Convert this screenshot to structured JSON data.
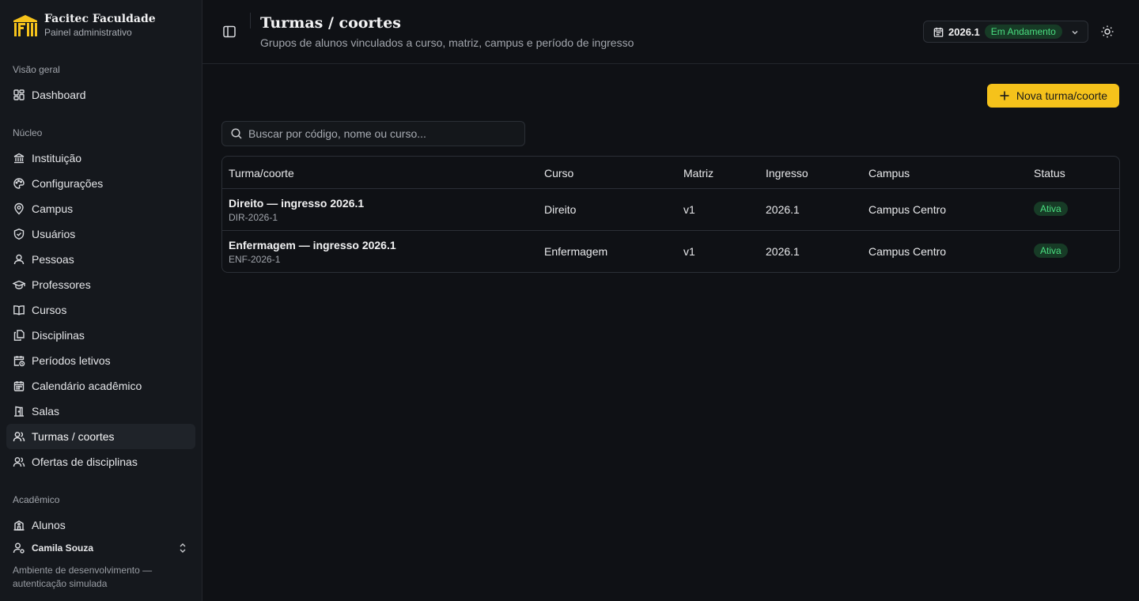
{
  "brand": {
    "title": "Facitec Faculdade",
    "subtitle": "Painel administrativo",
    "accent": "#f5c21b"
  },
  "sidebar": {
    "sections": [
      {
        "label": "Visão geral",
        "items": [
          {
            "label": "Dashboard",
            "icon": "dashboard-icon"
          }
        ]
      },
      {
        "label": "Núcleo",
        "items": [
          {
            "label": "Instituição",
            "icon": "institution-icon"
          },
          {
            "label": "Configurações",
            "icon": "palette-icon"
          },
          {
            "label": "Campus",
            "icon": "map-pin-icon"
          },
          {
            "label": "Usuários",
            "icon": "shield-icon"
          },
          {
            "label": "Pessoas",
            "icon": "user-icon"
          },
          {
            "label": "Professores",
            "icon": "graduation-cap-icon"
          },
          {
            "label": "Cursos",
            "icon": "book-icon"
          },
          {
            "label": "Disciplinas",
            "icon": "files-icon"
          },
          {
            "label": "Períodos letivos",
            "icon": "calendar-clock-icon"
          },
          {
            "label": "Calendário acadêmico",
            "icon": "calendar-icon"
          },
          {
            "label": "Salas",
            "icon": "door-icon"
          },
          {
            "label": "Turmas / coortes",
            "icon": "users-icon",
            "active": true
          },
          {
            "label": "Ofertas de disciplinas",
            "icon": "users-icon"
          }
        ]
      },
      {
        "label": "Acadêmico",
        "items": [
          {
            "label": "Alunos",
            "icon": "school-icon"
          }
        ]
      }
    ],
    "user": {
      "name": "Camila Souza"
    },
    "env_note": "Ambiente de desenvolvimento — autenticação simulada"
  },
  "header": {
    "title": "Turmas / coortes",
    "subtitle": "Grupos de alunos vinculados a curso, matriz, campus e período de ingresso",
    "period": {
      "year": "2026.1",
      "status": "Em Andamento"
    }
  },
  "actions": {
    "new_label": "Nova turma/coorte"
  },
  "search": {
    "placeholder": "Buscar por código, nome ou curso..."
  },
  "table": {
    "columns": [
      "Turma/coorte",
      "Curso",
      "Matriz",
      "Ingresso",
      "Campus",
      "Status"
    ],
    "rows": [
      {
        "name": "Direito — ingresso 2026.1",
        "code": "DIR-2026-1",
        "course": "Direito",
        "matrix": "v1",
        "entry": "2026.1",
        "campus": "Campus Centro",
        "status": "Ativa"
      },
      {
        "name": "Enfermagem — ingresso 2026.1",
        "code": "ENF-2026-1",
        "course": "Enfermagem",
        "matrix": "v1",
        "entry": "2026.1",
        "campus": "Campus Centro",
        "status": "Ativa"
      }
    ]
  },
  "colors": {
    "status_active": "#4ade80",
    "status_active_bg": "#173b26"
  }
}
